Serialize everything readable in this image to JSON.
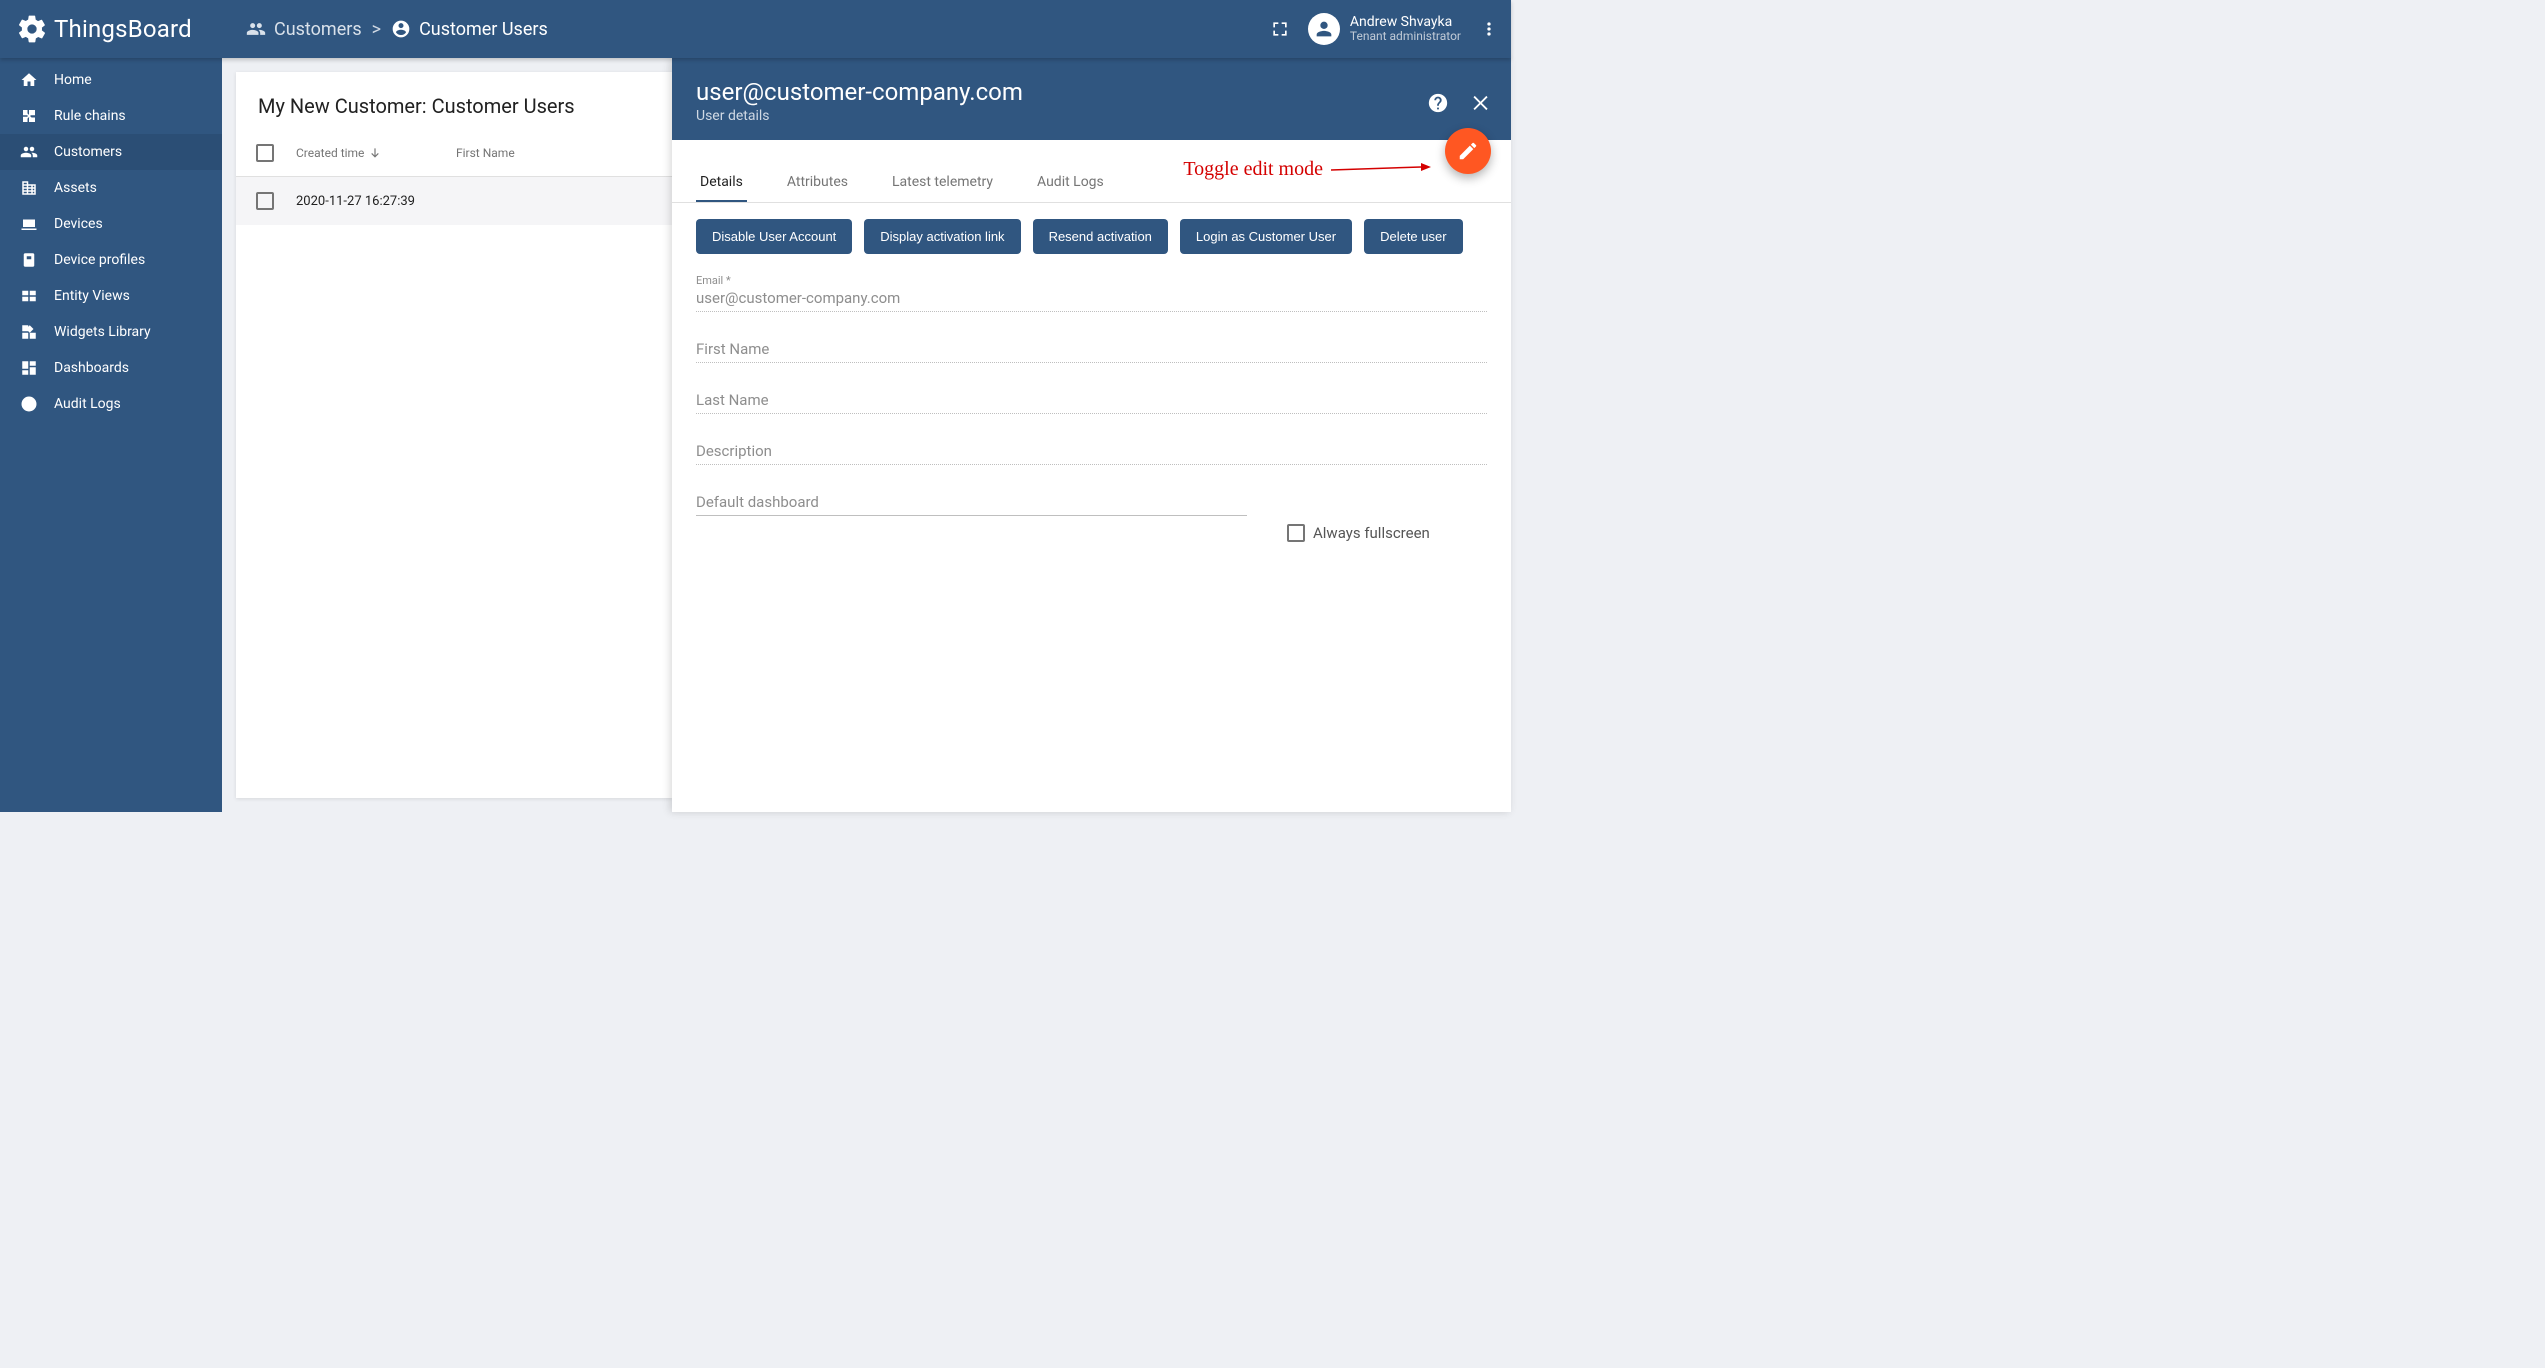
{
  "app": {
    "brand": "ThingsBoard"
  },
  "breadcrumbs": {
    "customers": "Customers",
    "customer_users": "Customer Users",
    "separator": ">"
  },
  "header_user": {
    "name": "Andrew Shvayka",
    "role": "Tenant administrator"
  },
  "sidebar": {
    "items": [
      {
        "id": "home",
        "label": "Home",
        "icon": "home"
      },
      {
        "id": "rule-chains",
        "label": "Rule chains",
        "icon": "rule"
      },
      {
        "id": "customers",
        "label": "Customers",
        "icon": "people",
        "active": true
      },
      {
        "id": "assets",
        "label": "Assets",
        "icon": "domain"
      },
      {
        "id": "devices",
        "label": "Devices",
        "icon": "devices"
      },
      {
        "id": "device-prof",
        "label": "Device profiles",
        "icon": "device_profile"
      },
      {
        "id": "entity-views",
        "label": "Entity Views",
        "icon": "entity"
      },
      {
        "id": "widgets",
        "label": "Widgets Library",
        "icon": "widgets"
      },
      {
        "id": "dashboards",
        "label": "Dashboards",
        "icon": "dashboard"
      },
      {
        "id": "audit-logs",
        "label": "Audit Logs",
        "icon": "audit"
      }
    ]
  },
  "list": {
    "title": "My New Customer: Customer Users",
    "columns": {
      "created": "Created time",
      "first_name": "First Name"
    },
    "rows": [
      {
        "created": "2020-11-27 16:27:39",
        "first_name": ""
      }
    ]
  },
  "details": {
    "title": "user@customer-company.com",
    "subtitle": "User details",
    "tabs": {
      "details": "Details",
      "attributes": "Attributes",
      "telemetry": "Latest telemetry",
      "audit": "Audit Logs"
    },
    "actions": {
      "disable": "Disable User Account",
      "display_link": "Display activation link",
      "resend": "Resend activation",
      "login_as": "Login as Customer User",
      "delete": "Delete user"
    },
    "form": {
      "email_label": "Email *",
      "email_value": "user@customer-company.com",
      "first_name_label": "First Name",
      "first_name_value": "",
      "last_name_label": "Last Name",
      "last_name_value": "",
      "description_label": "Description",
      "description_value": "",
      "default_dashboard_label": "Default dashboard",
      "always_fullscreen_label": "Always fullscreen"
    }
  },
  "annotation": {
    "toggle_edit": "Toggle edit mode"
  }
}
